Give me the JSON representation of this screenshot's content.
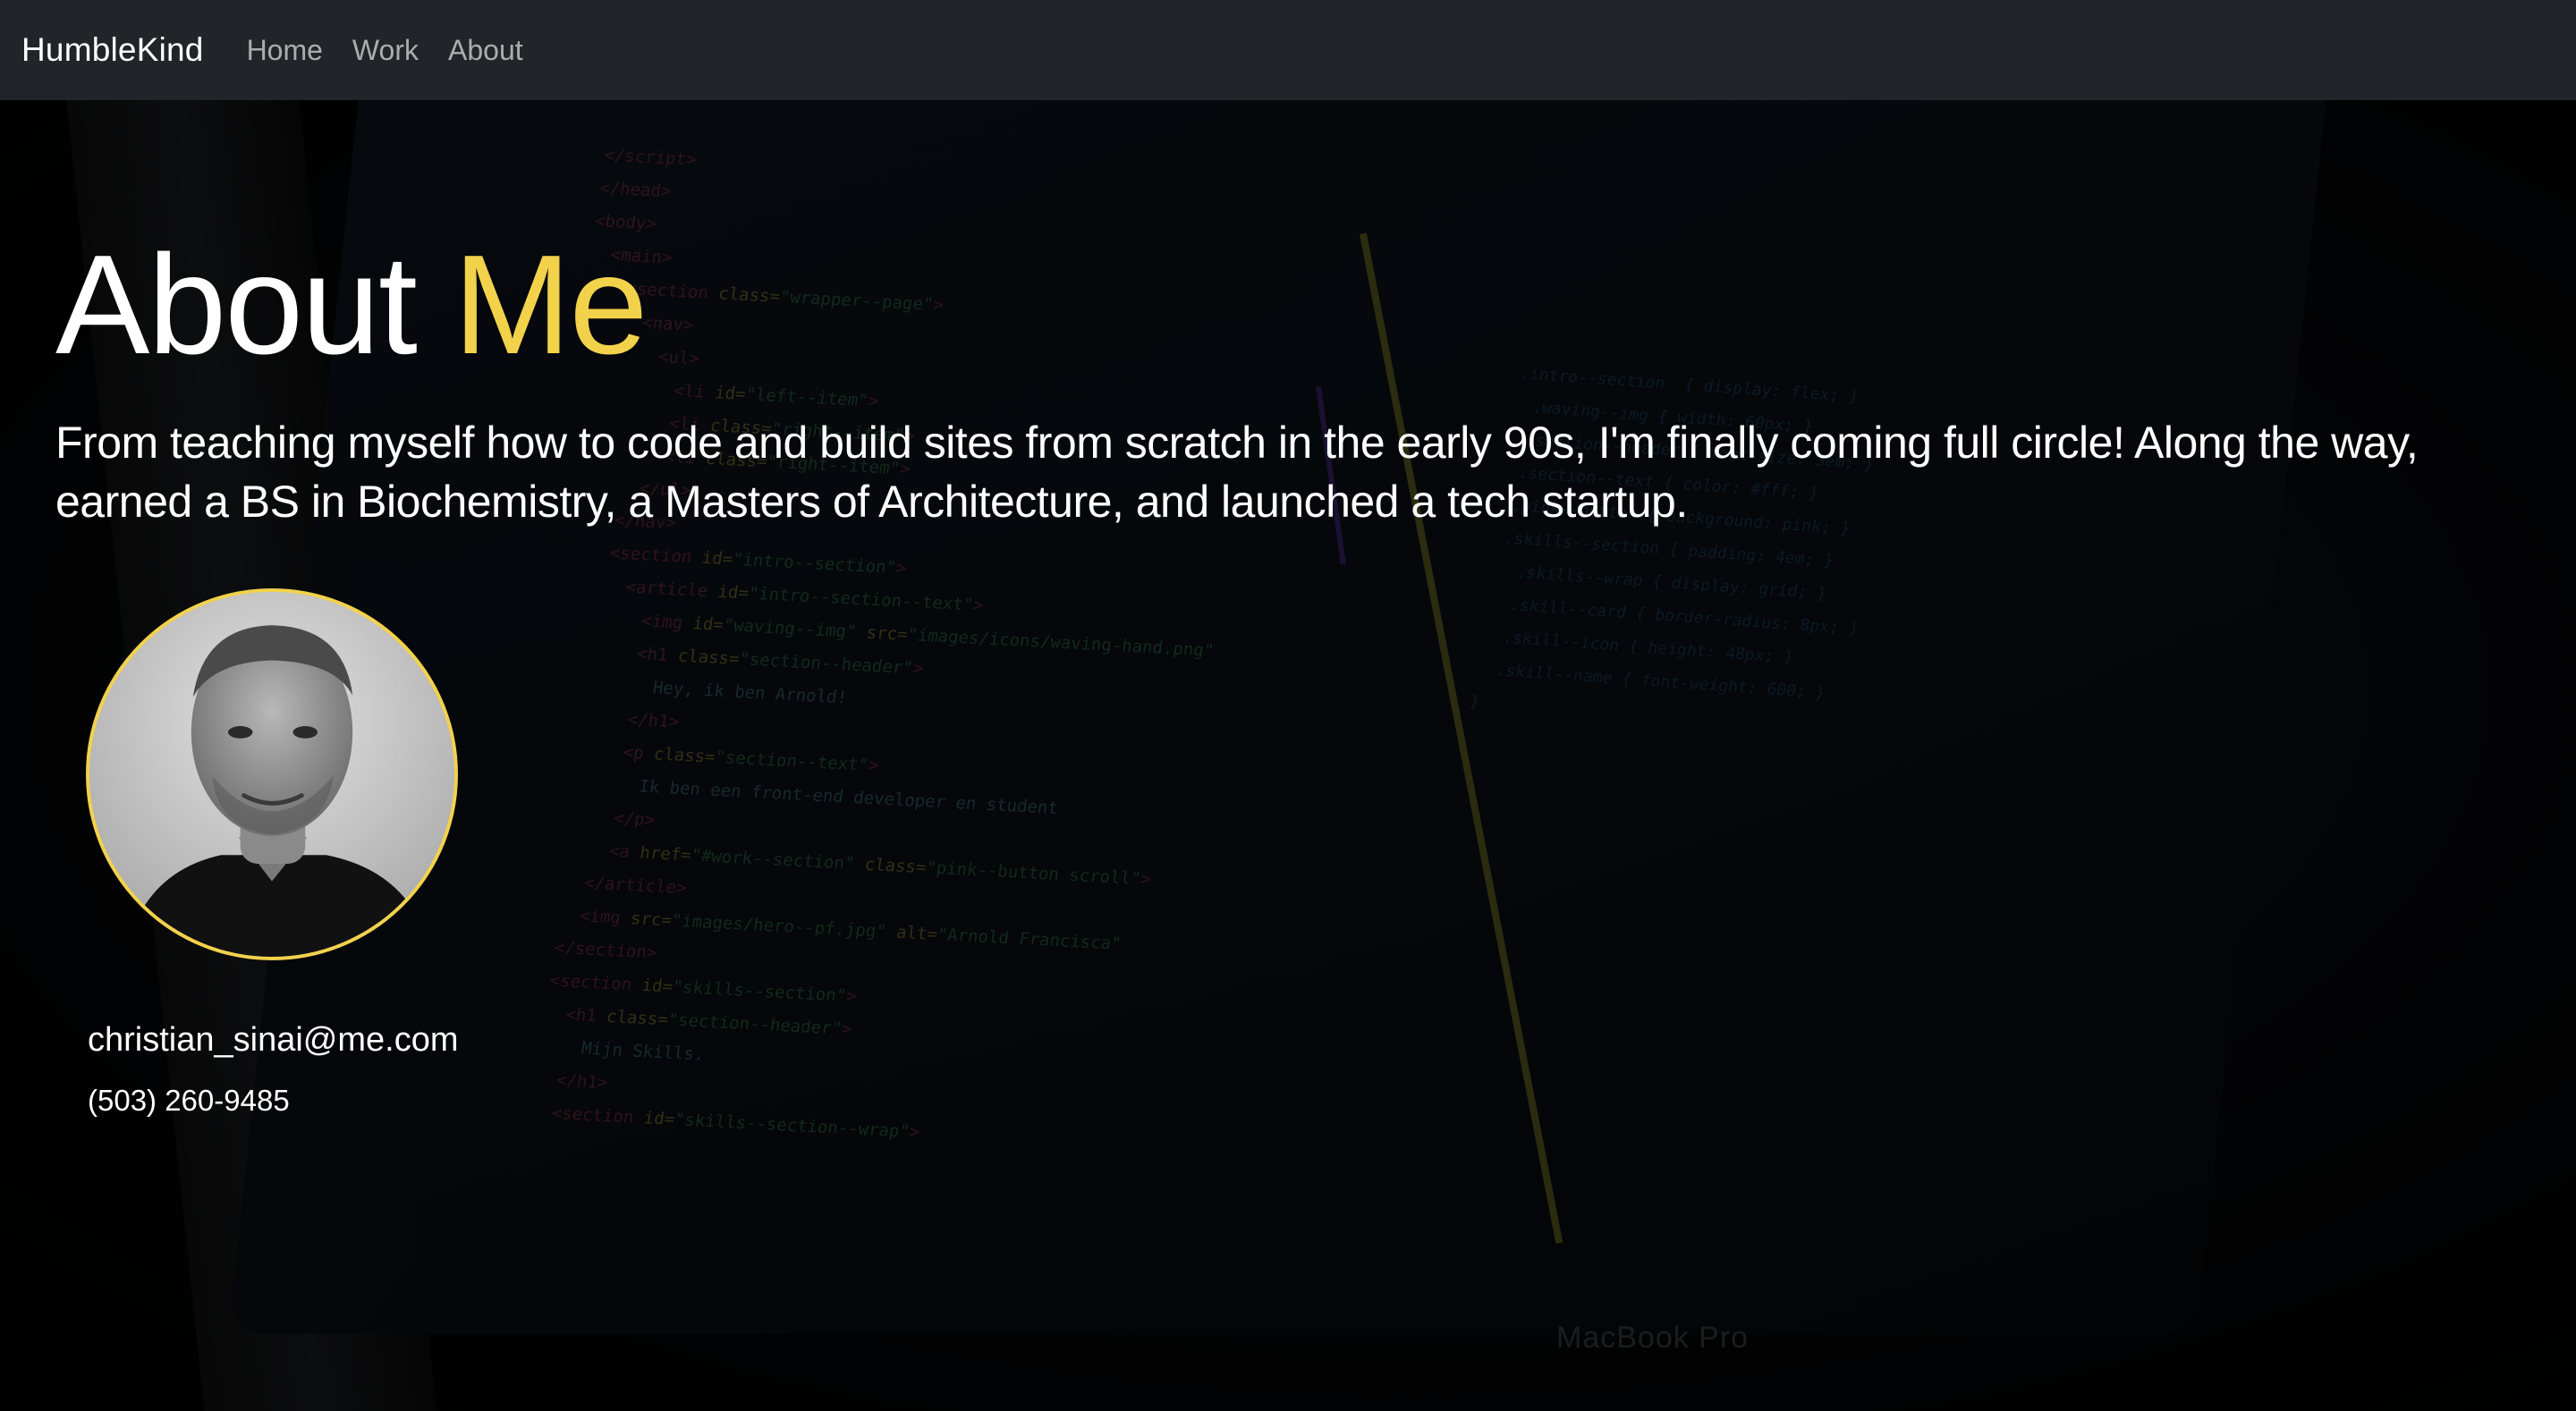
{
  "nav": {
    "brand": "HumbleKind",
    "links": [
      "Home",
      "Work",
      "About"
    ]
  },
  "hero": {
    "title_prefix": "About",
    "title_accent": "Me",
    "intro": "From teaching myself how to code and build sites from scratch in the early 90s, I'm finally coming full circle! Along the way, earned a BS in Biochemistry, a Masters of Architecture, and launched a tech startup.",
    "email": "christian_sinai@me.com",
    "phone": "(503) 260-9485"
  },
  "background": {
    "laptop_label": "MacBook Pro"
  },
  "colors": {
    "navbar": "#212529",
    "accent": "#f2d24b",
    "text": "#ffffff"
  }
}
